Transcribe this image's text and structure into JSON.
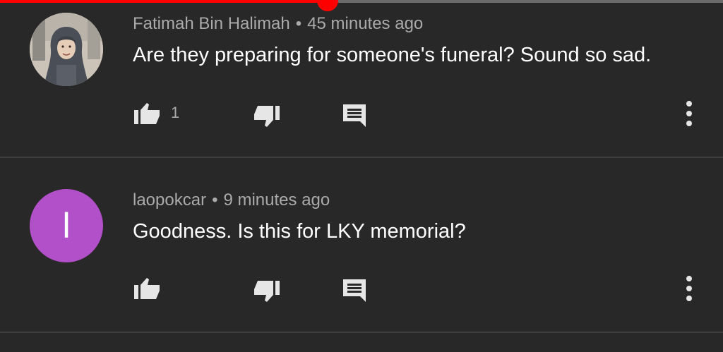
{
  "progress": {
    "percent": 45.3
  },
  "colors": {
    "background": "#282828",
    "progress_fill": "#ff0000",
    "avatar_letter_bg": "#b150c8"
  },
  "comments": [
    {
      "author": "Fatimah Bin Halimah",
      "separator": "•",
      "time": "45 minutes ago",
      "text": "Are they preparing for someone's funeral? Sound so sad.",
      "likes": "1",
      "avatar": {
        "type": "photo",
        "letter": ""
      },
      "icons": [
        "thumb-up-icon",
        "thumb-down-icon",
        "reply-icon",
        "more-vert-icon"
      ]
    },
    {
      "author": "laopokcar",
      "separator": "•",
      "time": "9 minutes ago",
      "text": "Goodness. Is this for LKY memorial?",
      "likes": "",
      "avatar": {
        "type": "letter",
        "letter": "l"
      },
      "icons": [
        "thumb-up-icon",
        "thumb-down-icon",
        "reply-icon",
        "more-vert-icon"
      ]
    }
  ]
}
